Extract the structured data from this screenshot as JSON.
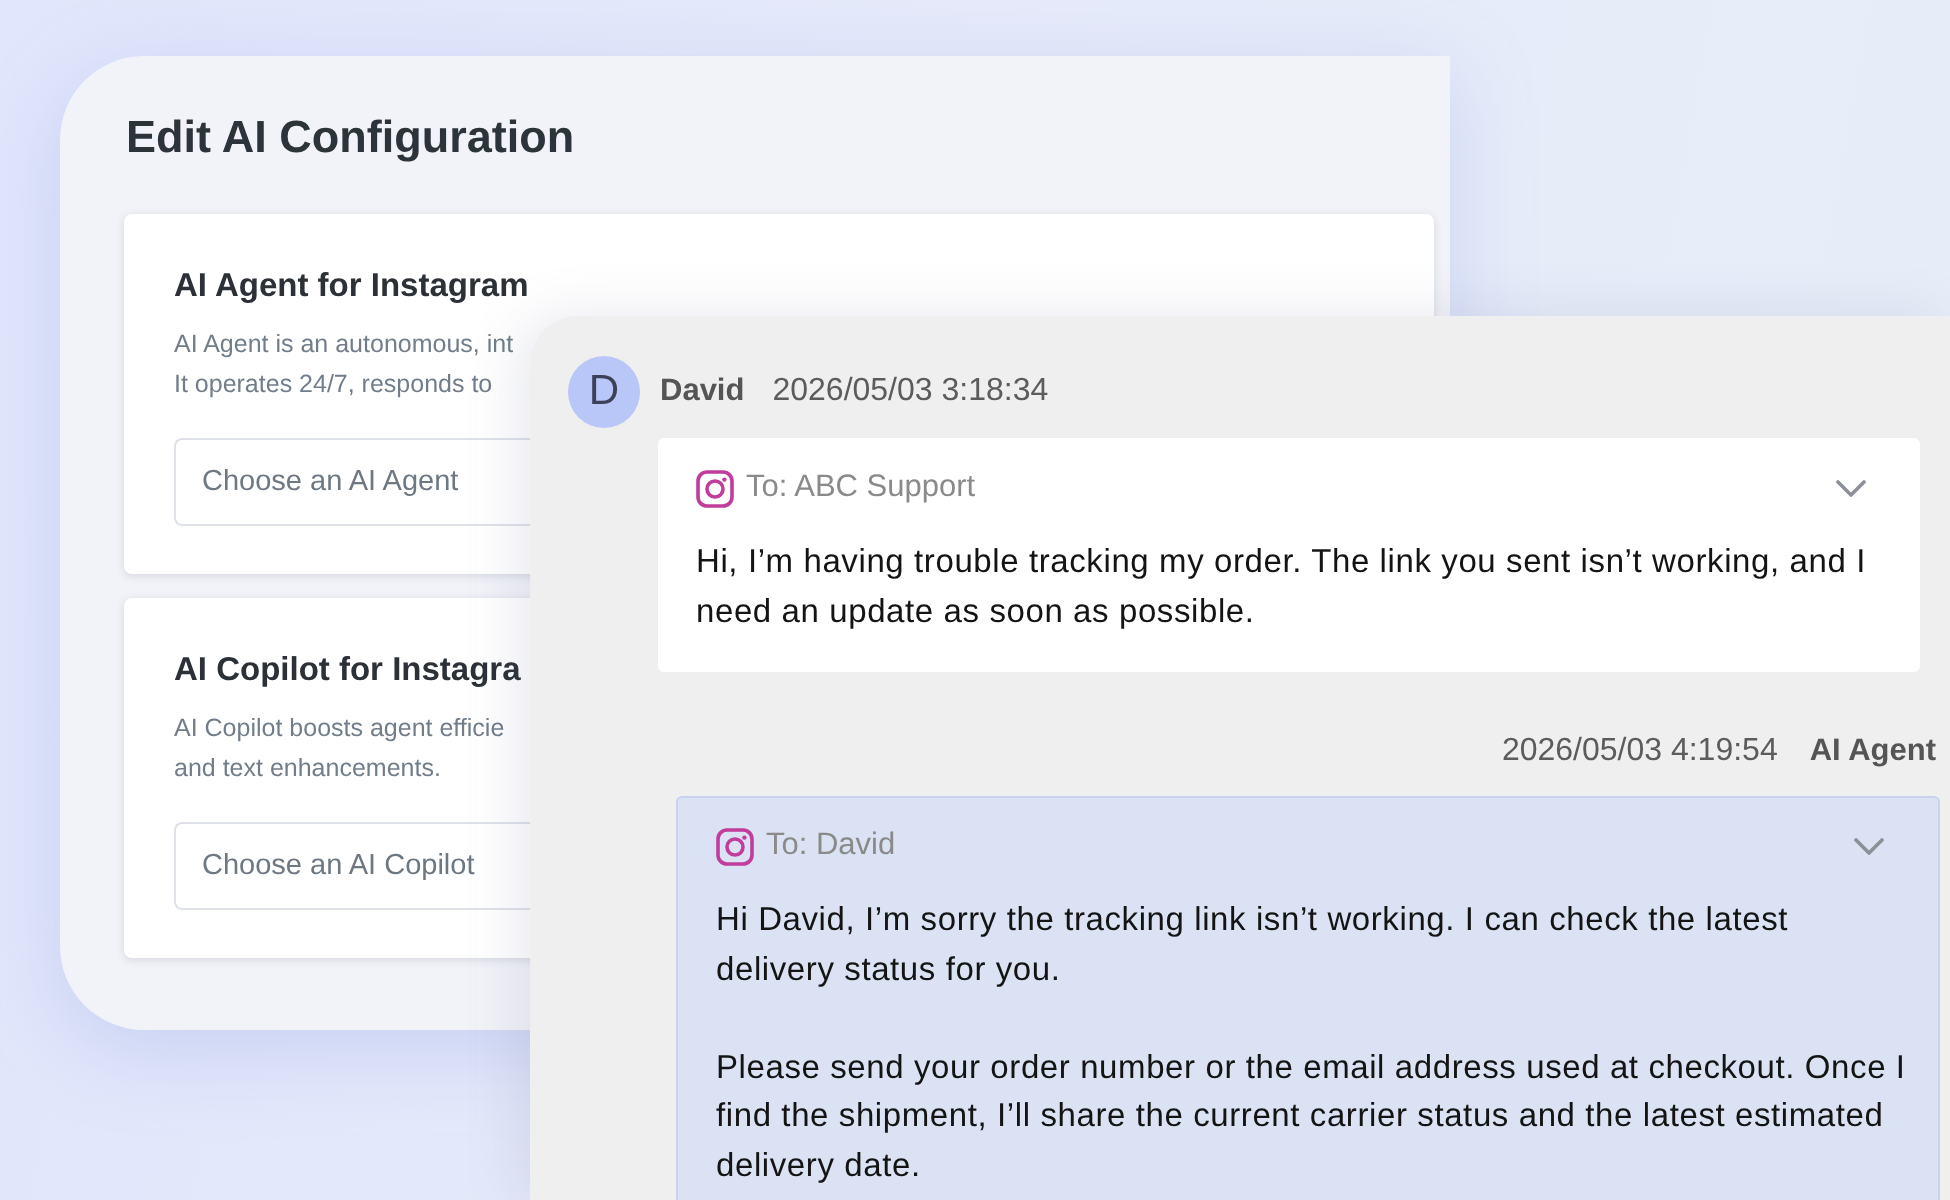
{
  "config_panel": {
    "title": "Edit AI Configuration",
    "sections": [
      {
        "title": "AI Agent for Instagram",
        "description_lines": [
          "AI Agent is an autonomous, int",
          "It operates 24/7, responds to"
        ],
        "placeholder": "Choose an AI Agent"
      },
      {
        "title": "AI Copilot for Instagra",
        "description_lines": [
          "AI Copilot boosts agent efficie",
          "and text enhancements."
        ],
        "placeholder": "Choose an AI Copilot"
      }
    ]
  },
  "conversation": {
    "messages": [
      {
        "kind": "incoming",
        "avatar_initial": "D",
        "sender": "David",
        "time": "2026/05/03 3:18:34",
        "recipient": "To: ABC Support",
        "paragraphs": [
          "Hi, I’m having trouble tracking my order. The link you sent isn’t working, and I need an update as soon as possible."
        ]
      },
      {
        "kind": "outgoing",
        "sender": "AI Agent",
        "time": "2026/05/03 4:19:54",
        "recipient": "To: David",
        "paragraphs": [
          "Hi David, I’m sorry the tracking link isn’t working. I can check the latest delivery status for you.",
          "Please send your order number or the email address used at checkout. Once I find the shipment, I’ll share the current carrier status and the latest estimated delivery date."
        ]
      }
    ]
  }
}
